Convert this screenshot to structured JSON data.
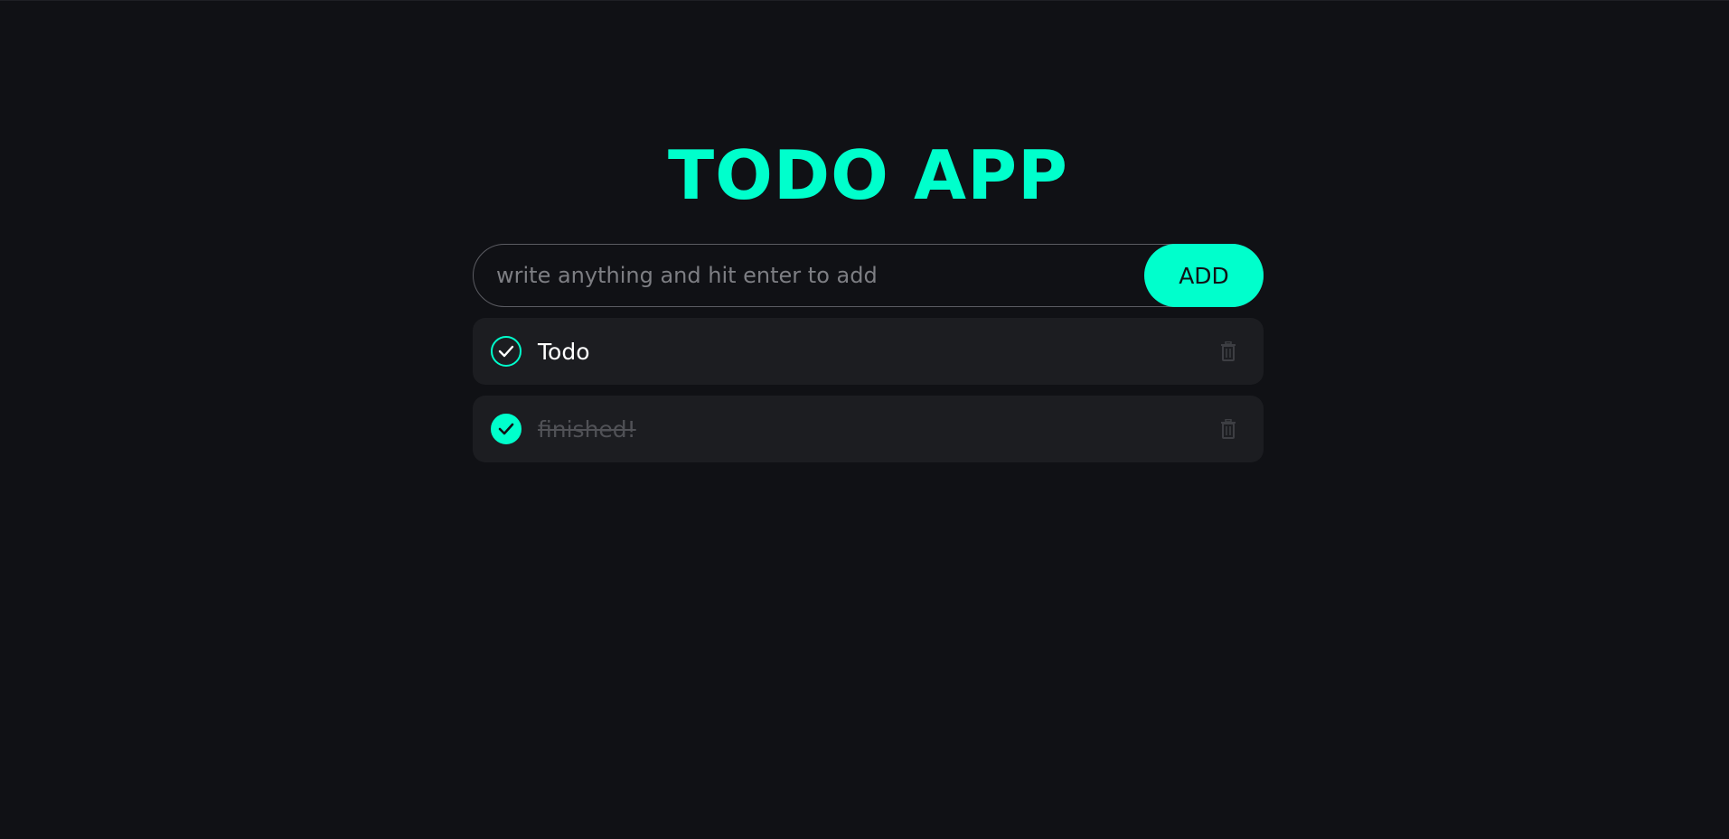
{
  "app": {
    "title": "TODO APP"
  },
  "input": {
    "placeholder": "write anything and hit enter to add",
    "value": ""
  },
  "add_button": {
    "label": "ADD"
  },
  "todos": [
    {
      "text": "Todo",
      "completed": false
    },
    {
      "text": "finished!",
      "completed": true
    }
  ],
  "icons": {
    "check": "check-circle-icon",
    "delete": "trash-icon"
  },
  "colors": {
    "background": "#101115",
    "accent": "#00ffcc",
    "card": "#1c1d21",
    "completed_text": "#505156"
  }
}
